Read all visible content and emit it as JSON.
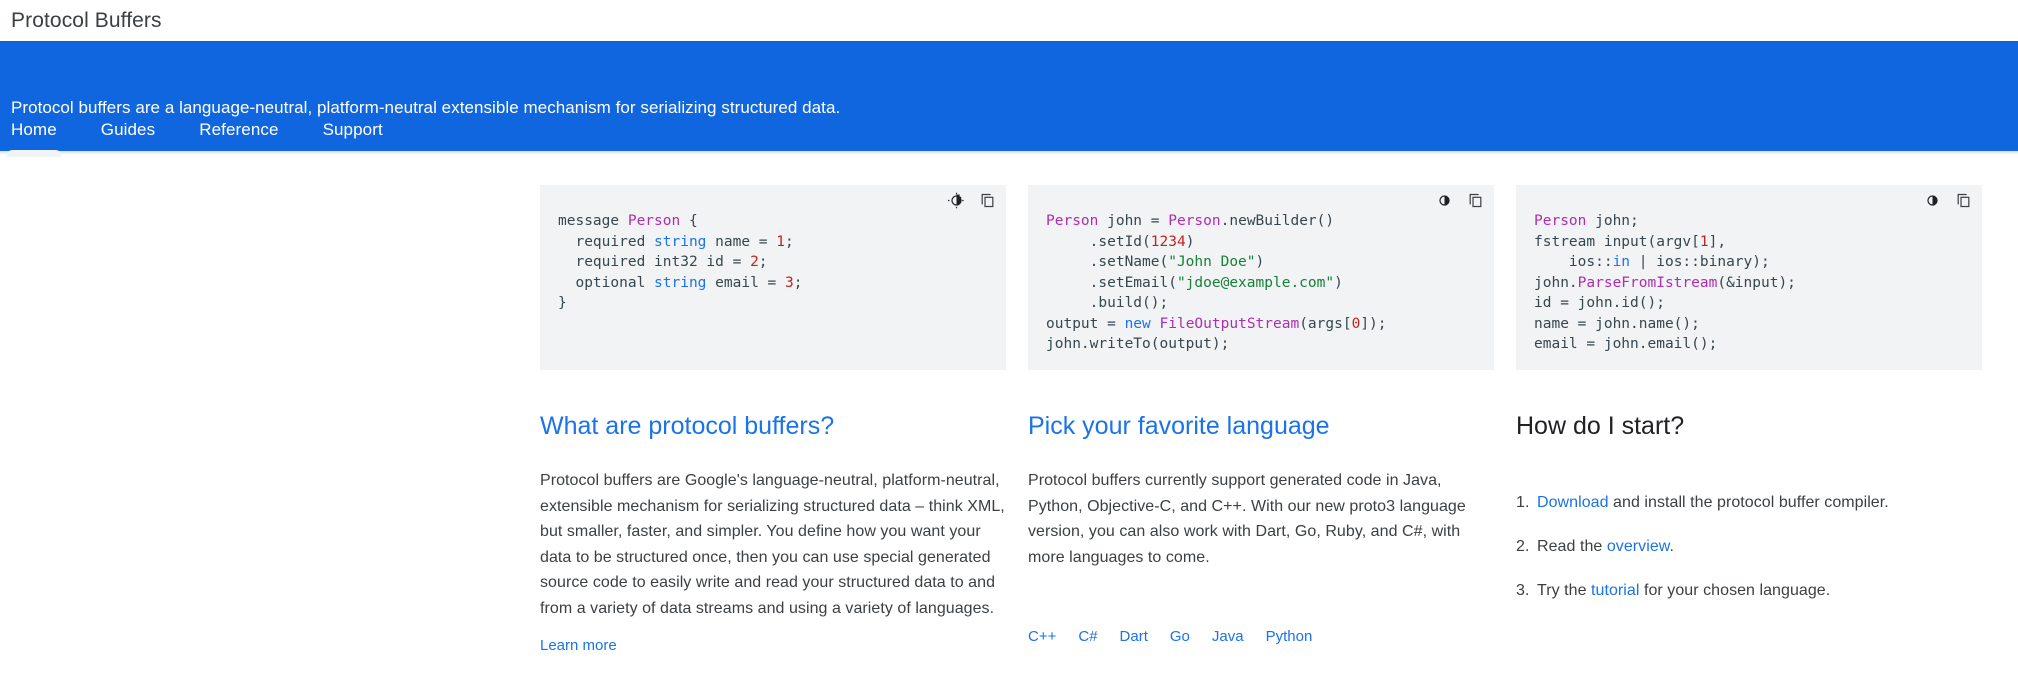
{
  "header": {
    "title": "Protocol Buffers"
  },
  "banner": {
    "tagline": "Protocol buffers are a language-neutral, platform-neutral extensible mechanism for serializing structured data.",
    "background_color": "#1066DE",
    "nav": [
      {
        "label": "Home",
        "active": true
      },
      {
        "label": "Guides",
        "active": false
      },
      {
        "label": "Reference",
        "active": false
      },
      {
        "label": "Support",
        "active": false
      }
    ]
  },
  "code_blocks": [
    {
      "language": "proto",
      "toolbar": {
        "theme_toggle": "brightness-icon",
        "copy": "copy-icon"
      },
      "lines": [
        [
          {
            "t": "message ",
            "c": ""
          },
          {
            "t": "Person",
            "c": "tok-type"
          },
          {
            "t": " {",
            "c": ""
          }
        ],
        [
          {
            "t": "  required ",
            "c": ""
          },
          {
            "t": "string",
            "c": "tok-kw"
          },
          {
            "t": " name = ",
            "c": ""
          },
          {
            "t": "1",
            "c": "tok-num"
          },
          {
            "t": ";",
            "c": ""
          }
        ],
        [
          {
            "t": "  required int32 id = ",
            "c": ""
          },
          {
            "t": "2",
            "c": "tok-num"
          },
          {
            "t": ";",
            "c": ""
          }
        ],
        [
          {
            "t": "  optional ",
            "c": ""
          },
          {
            "t": "string",
            "c": "tok-kw"
          },
          {
            "t": " email = ",
            "c": ""
          },
          {
            "t": "3",
            "c": "tok-num"
          },
          {
            "t": ";",
            "c": ""
          }
        ],
        [
          {
            "t": "}",
            "c": ""
          }
        ]
      ]
    },
    {
      "language": "java",
      "toolbar": {
        "theme_toggle": "brightness-icon",
        "copy": "copy-icon"
      },
      "lines": [
        [
          {
            "t": "Person",
            "c": "tok-type"
          },
          {
            "t": " john = ",
            "c": ""
          },
          {
            "t": "Person",
            "c": "tok-type"
          },
          {
            "t": ".newBuilder()",
            "c": ""
          }
        ],
        [
          {
            "t": "     .setId(",
            "c": ""
          },
          {
            "t": "1234",
            "c": "tok-num"
          },
          {
            "t": ")",
            "c": ""
          }
        ],
        [
          {
            "t": "     .setName(",
            "c": ""
          },
          {
            "t": "\"John Doe\"",
            "c": "tok-str"
          },
          {
            "t": ")",
            "c": ""
          }
        ],
        [
          {
            "t": "     .setEmail(",
            "c": ""
          },
          {
            "t": "\"jdoe@example.com\"",
            "c": "tok-str"
          },
          {
            "t": ")",
            "c": ""
          }
        ],
        [
          {
            "t": "     .build();",
            "c": ""
          }
        ],
        [
          {
            "t": "output = ",
            "c": ""
          },
          {
            "t": "new",
            "c": "tok-kw"
          },
          {
            "t": " ",
            "c": ""
          },
          {
            "t": "FileOutputStream",
            "c": "tok-fn"
          },
          {
            "t": "(args[",
            "c": ""
          },
          {
            "t": "0",
            "c": "tok-num"
          },
          {
            "t": "]);",
            "c": ""
          }
        ],
        [
          {
            "t": "john.writeTo(output);",
            "c": ""
          }
        ]
      ]
    },
    {
      "language": "cpp",
      "toolbar": {
        "theme_toggle": "brightness-icon",
        "copy": "copy-icon"
      },
      "lines": [
        [
          {
            "t": "Person",
            "c": "tok-type"
          },
          {
            "t": " john;",
            "c": ""
          }
        ],
        [
          {
            "t": "fstream input(argv[",
            "c": ""
          },
          {
            "t": "1",
            "c": "tok-num"
          },
          {
            "t": "],",
            "c": ""
          }
        ],
        [
          {
            "t": "    ios::",
            "c": ""
          },
          {
            "t": "in",
            "c": "tok-kw"
          },
          {
            "t": " | ios::binary);",
            "c": ""
          }
        ],
        [
          {
            "t": "john.",
            "c": ""
          },
          {
            "t": "ParseFromIstream",
            "c": "tok-fn"
          },
          {
            "t": "(&input);",
            "c": ""
          }
        ],
        [
          {
            "t": "id = john.id();",
            "c": ""
          }
        ],
        [
          {
            "t": "name = john.name();",
            "c": ""
          }
        ],
        [
          {
            "t": "email = john.email();",
            "c": ""
          }
        ]
      ]
    }
  ],
  "sections": {
    "what": {
      "heading": "What are protocol buffers?",
      "body": "Protocol buffers are Google's language-neutral, platform-neutral, extensible mechanism for serializing structured data – think XML, but smaller, faster, and simpler. You define how you want your data to be structured once, then you can use special generated source code to easily write and read your structured data to and from a variety of data streams and using a variety of languages.",
      "link": "Learn more"
    },
    "pick": {
      "heading": "Pick your favorite language",
      "body": "Protocol buffers currently support generated code in Java, Python, Objective-C, and C++. With our new proto3 language version, you can also work with Dart, Go, Ruby, and C#, with more languages to come.",
      "languages": [
        "C++",
        "C#",
        "Dart",
        "Go",
        "Java",
        "Python"
      ]
    },
    "start": {
      "heading": "How do I start?",
      "steps": [
        {
          "link": "Download",
          "before": "",
          "after": " and install the protocol buffer compiler."
        },
        {
          "link": "overview",
          "before": "Read the ",
          "after": "."
        },
        {
          "link": "tutorial",
          "before": "Try the ",
          "after": " for your chosen language."
        }
      ]
    }
  },
  "colors": {
    "brand_blue": "#1066DE",
    "link_blue": "#1a73e8",
    "code_bg": "#f1f3f4",
    "text": "#3c4043"
  }
}
